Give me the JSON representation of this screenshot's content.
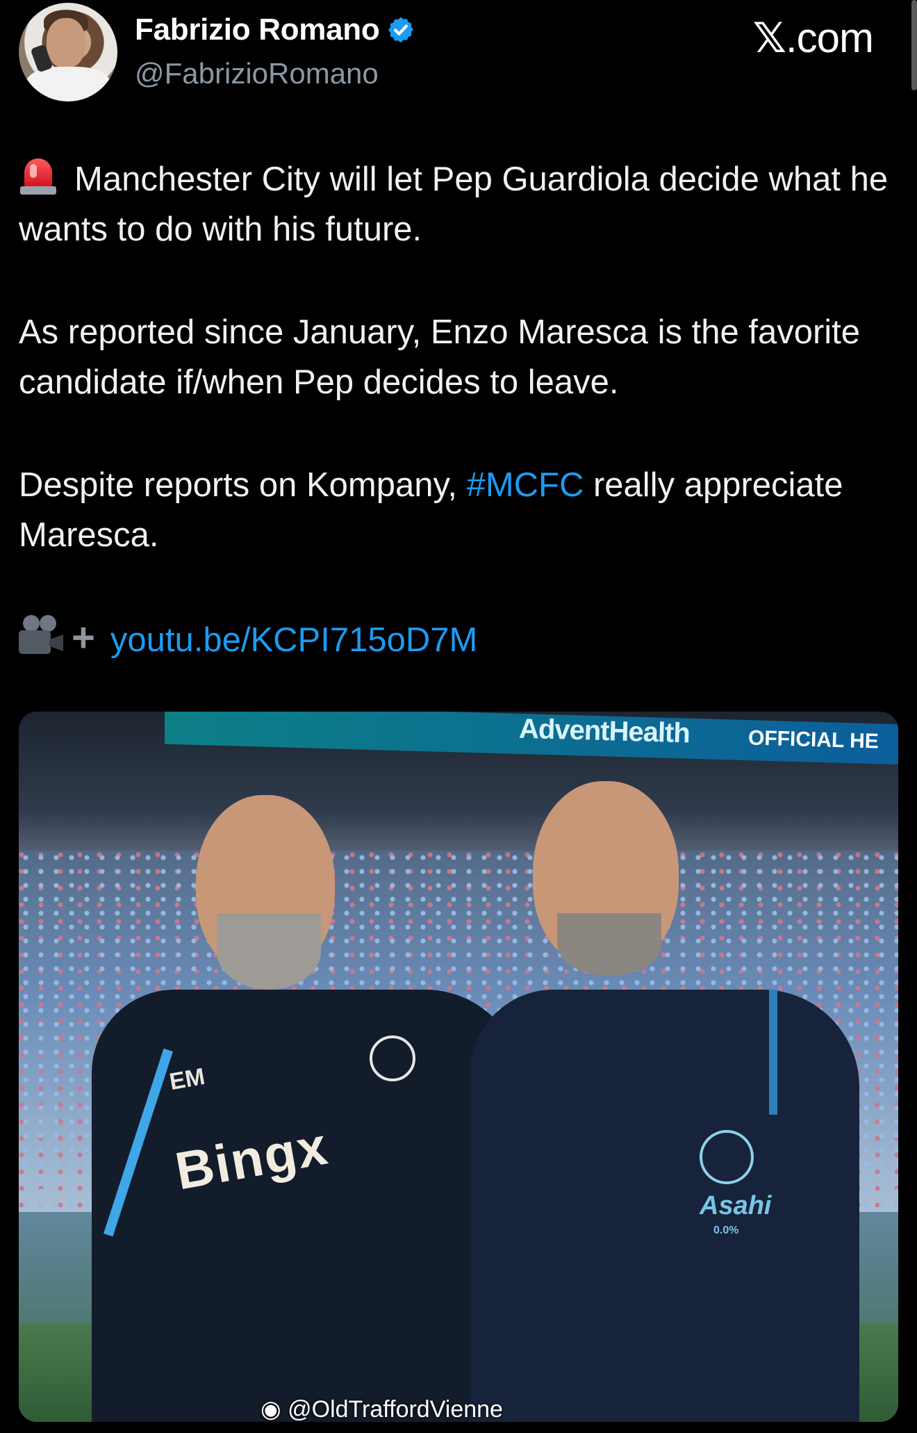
{
  "author": {
    "name": "Fabrizio Romano",
    "handle": "@FabrizioRomano",
    "verified_icon": "verified-badge-icon"
  },
  "site": {
    "label": ".com"
  },
  "tweet": {
    "paragraph1": "Manchester City will let Pep Guardiola decide what he wants to do with his future.",
    "paragraph2": "As reported since January, Enzo Maresca is the favorite candidate if/when Pep decides to leave.",
    "paragraph3_before": "Despite reports on Kompany, ",
    "hashtag": "#MCFC",
    "paragraph3_after": " really appreciate Maresca.",
    "link": "youtu.be/KCPI715oD7M"
  },
  "photo": {
    "banner_text": "AdventHealth",
    "banner_text2": "OFFICIAL HE",
    "left_shirt_sponsor": "Bingx",
    "left_initials": "EM",
    "right_shirt_sponsor": "Asahi",
    "right_shirt_sub": "0.0%",
    "watermark": "@OldTraffordVienne"
  },
  "colors": {
    "accent": "#1d9bf0",
    "background": "#000000",
    "text": "#e7e9ea",
    "muted": "#8b98a5"
  }
}
